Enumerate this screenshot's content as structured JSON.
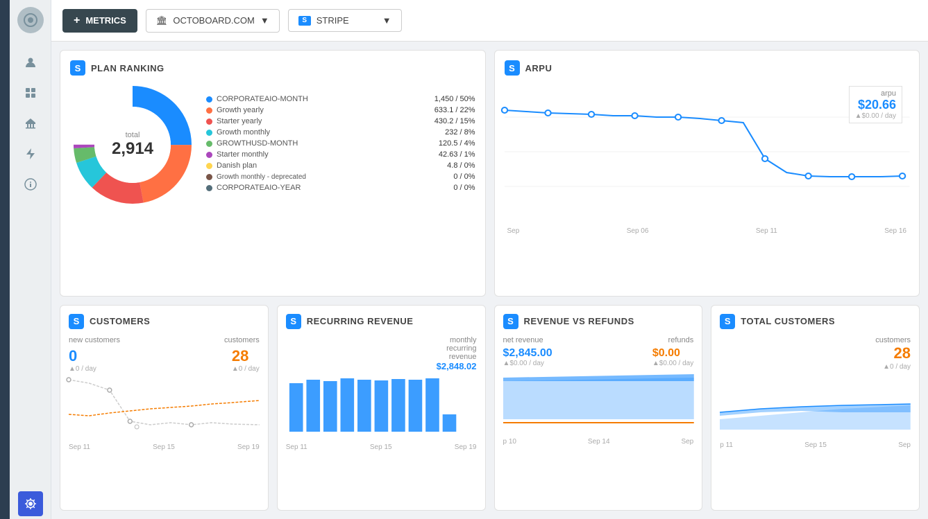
{
  "sidebar": {
    "icons": [
      "person",
      "grid",
      "bank",
      "flash",
      "info",
      "settings"
    ]
  },
  "topbar": {
    "metrics_label": "METRICS",
    "octoboard_label": "OCTOBOARD.COM",
    "stripe_label": "STRIPE"
  },
  "plan_ranking": {
    "title": "PLAN RANKING",
    "total_label": "total",
    "total_value": "2,914",
    "legend": [
      {
        "name": "CORPORATEAIO-MONTH",
        "value": "1,450 / 50%",
        "color": "#1a8cff"
      },
      {
        "name": "Growth yearly",
        "value": "633.1 / 22%",
        "color": "#ff7043"
      },
      {
        "name": "Starter yearly",
        "value": "430.2 / 15%",
        "color": "#ef5350"
      },
      {
        "name": "Growth monthly",
        "value": "232 /  8%",
        "color": "#26c6da"
      },
      {
        "name": "GROWTHUSD-MONTH",
        "value": "120.5 /  4%",
        "color": "#66bb6a"
      },
      {
        "name": "Starter monthly",
        "value": "42.63 /  1%",
        "color": "#ab47bc"
      },
      {
        "name": "Danish plan",
        "value": "4.8  /  0%",
        "color": "#ffd54f"
      },
      {
        "name": "Growth monthly - deprecated",
        "value": "0  /  0%",
        "color": "#795548"
      },
      {
        "name": "CORPORATEAIO-YEAR",
        "value": "0  /  0%",
        "color": "#546e7a"
      }
    ],
    "donut_segments": [
      {
        "pct": 50,
        "color": "#1a8cff"
      },
      {
        "pct": 22,
        "color": "#ff7043"
      },
      {
        "pct": 15,
        "color": "#ef5350"
      },
      {
        "pct": 8,
        "color": "#26c6da"
      },
      {
        "pct": 4,
        "color": "#66bb6a"
      },
      {
        "pct": 1,
        "color": "#ab47bc"
      }
    ]
  },
  "arpu": {
    "title": "ARPU",
    "tooltip_label": "arpu",
    "value": "$20.66",
    "sub_value": "▲$0.00 / day",
    "x_labels": [
      "Sep",
      "Sep 06",
      "Sep 11",
      "Sep 16"
    ]
  },
  "customers": {
    "title": "CUSTOMERS",
    "label_new": "new customers",
    "label_customers": "customers",
    "value_new": "0",
    "value_new_sub": "▲0 / day",
    "value_customers": "28",
    "value_customers_sub": "▲0 / day",
    "x_labels": [
      "Sep 11",
      "Sep 15",
      "Sep 19"
    ]
  },
  "recurring_revenue": {
    "title": "RECURRING REVENUE",
    "tooltip_label": "monthly recurring revenue",
    "value": "$2,848.02",
    "x_labels": [
      "Sep 11",
      "Sep 15",
      "Sep 19"
    ]
  },
  "revenue_vs_refunds": {
    "title": "REVENUE VS REFUNDS",
    "label_net": "net revenue",
    "label_refunds": "refunds",
    "value_net": "$2,845.00",
    "value_net_sub": "▲$0.00 / day",
    "value_refunds": "$0.00",
    "value_refunds_sub": "▲$0.00 / day",
    "x_labels": [
      "p 10",
      "Sep 14",
      "Sep"
    ]
  },
  "total_customers": {
    "title": "TOTAL CUSTOMERS",
    "tooltip_label": "customers",
    "value": "28",
    "value_sub": "▲0 / day",
    "x_labels": [
      "p 11",
      "Sep 15",
      "Sep"
    ]
  }
}
